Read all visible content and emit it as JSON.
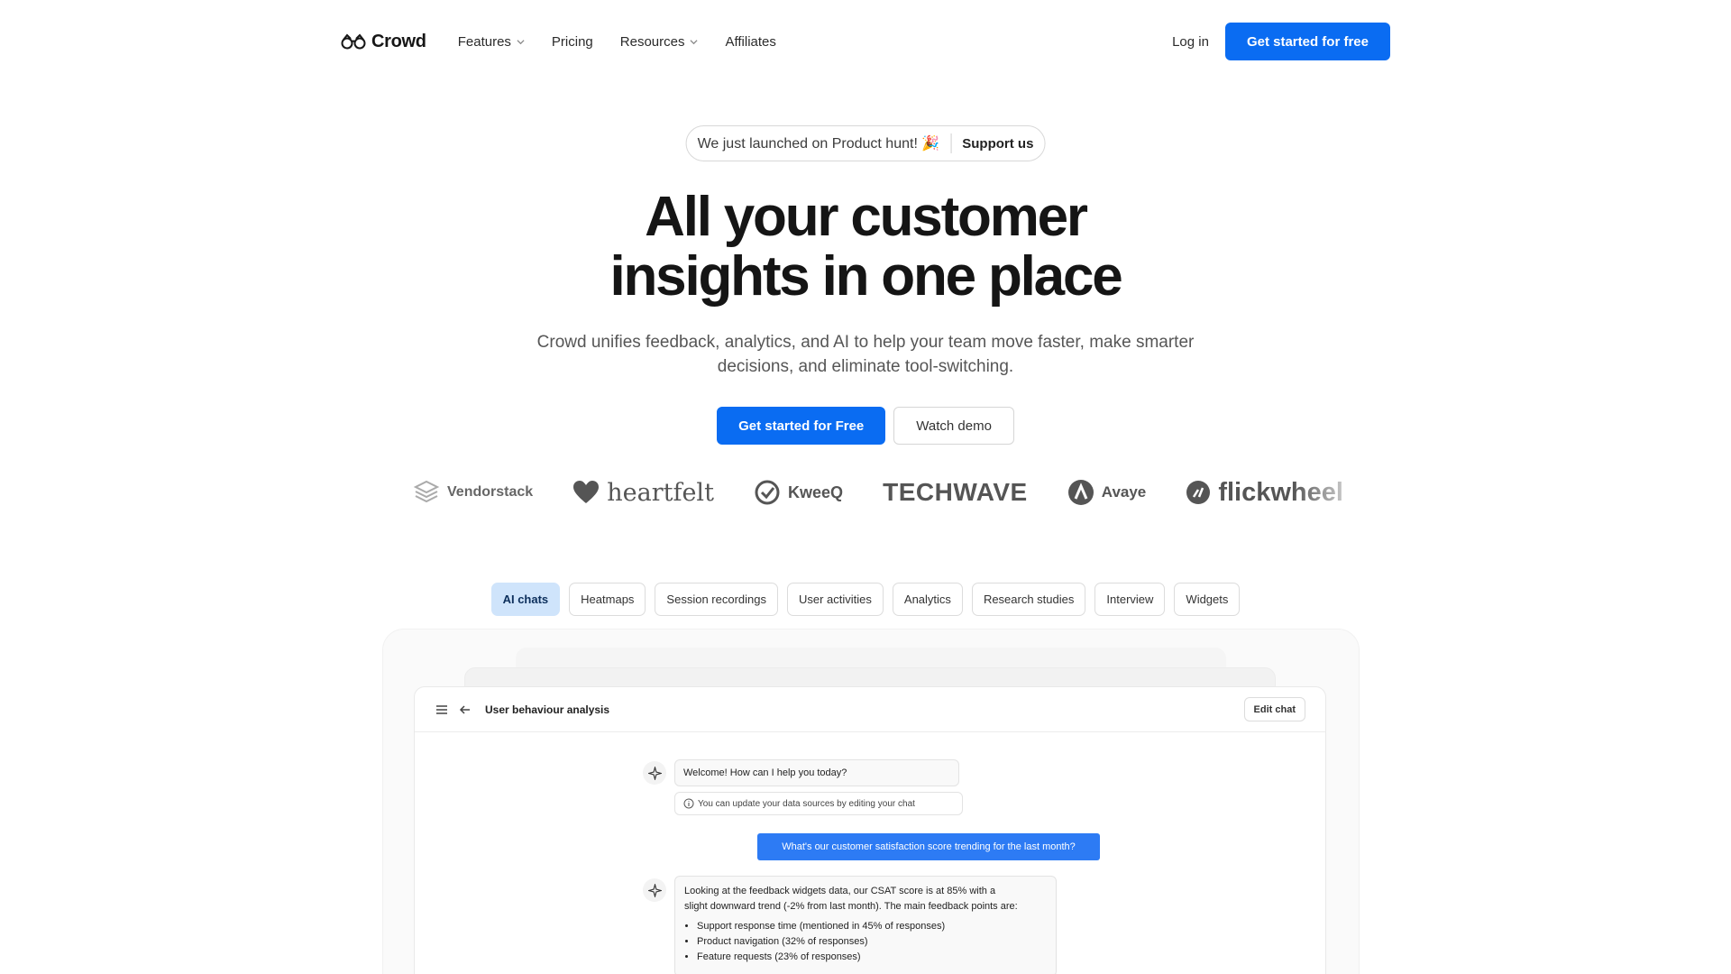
{
  "nav": {
    "brand": "Crowd",
    "links": [
      {
        "label": "Features",
        "dropdown": true
      },
      {
        "label": "Pricing",
        "dropdown": false
      },
      {
        "label": "Resources",
        "dropdown": true
      },
      {
        "label": "Affiliates",
        "dropdown": false
      }
    ],
    "login": "Log in",
    "cta": "Get started for free"
  },
  "hero": {
    "announcement": "We just launched on Product hunt! 🎉",
    "announcement_link": "Support us",
    "title_line1": "All your customer",
    "title_line2": "insights in one place",
    "subtitle_line1": "Crowd unifies feedback, analytics, and AI to help your team move faster, make smarter",
    "subtitle_line2": "decisions, and eliminate tool-switching.",
    "cta_primary": "Get started for Free",
    "cta_secondary": "Watch demo"
  },
  "logos": [
    "Vendorstack",
    "heartfelt",
    "KweeQ",
    "TECHWAVE",
    "Avaye",
    "flickwheel"
  ],
  "tabs": [
    "AI chats",
    "Heatmaps",
    "Session recordings",
    "User activities",
    "Analytics",
    "Research studies",
    "Interview",
    "Widgets"
  ],
  "active_tab": "AI chats",
  "demo": {
    "window_title": "User behaviour analysis",
    "edit_button": "Edit chat",
    "welcome": "Welcome! How can I help you today?",
    "notice": "You can update your data sources by editing your chat",
    "user_question": "What's our customer satisfaction score trending for the last month?",
    "answer_line1": "Looking at the feedback widgets data, our CSAT score is at 85% with a",
    "answer_line2": "slight downward trend (-2% from last month). The main feedback points are:",
    "answer_points": [
      "Support response time (mentioned in 45% of responses)",
      "Product navigation (32% of responses)",
      "Feature requests (23% of responses)"
    ]
  },
  "colors": {
    "primary": "#0a6cf2",
    "active_tab_bg": "#cfe4fb",
    "user_bubble": "#2d7bf4"
  }
}
